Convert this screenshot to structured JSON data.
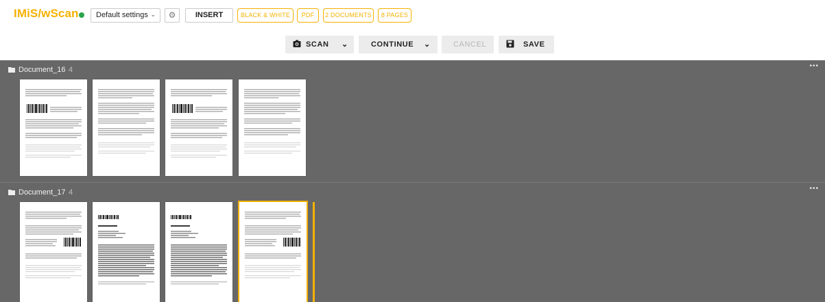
{
  "header": {
    "brand": "IMiS/wScan",
    "status_color": "#2ca44b",
    "settings_select": "Default settings",
    "insert_label": "INSERT",
    "chips": [
      "BLACK & WHITE",
      "PDF",
      "2 DOCUMENTS",
      "8 PAGES"
    ]
  },
  "actions": {
    "scan_label": "SCAN",
    "continue_label": "CONTINUE",
    "cancel_label": "CANCEL",
    "save_label": "SAVE"
  },
  "documents": [
    {
      "name": "Document_16",
      "count": "4"
    },
    {
      "name": "Document_17",
      "count": "4"
    }
  ],
  "colors": {
    "accent": "#f5b100",
    "group_bg": "#676767",
    "action_bg": "#ececec"
  },
  "icons": {
    "more": "ellipsis-icon",
    "folder": "folder-icon",
    "camera": "camera-icon",
    "save": "floppy-icon",
    "settings": "gear-icon"
  }
}
